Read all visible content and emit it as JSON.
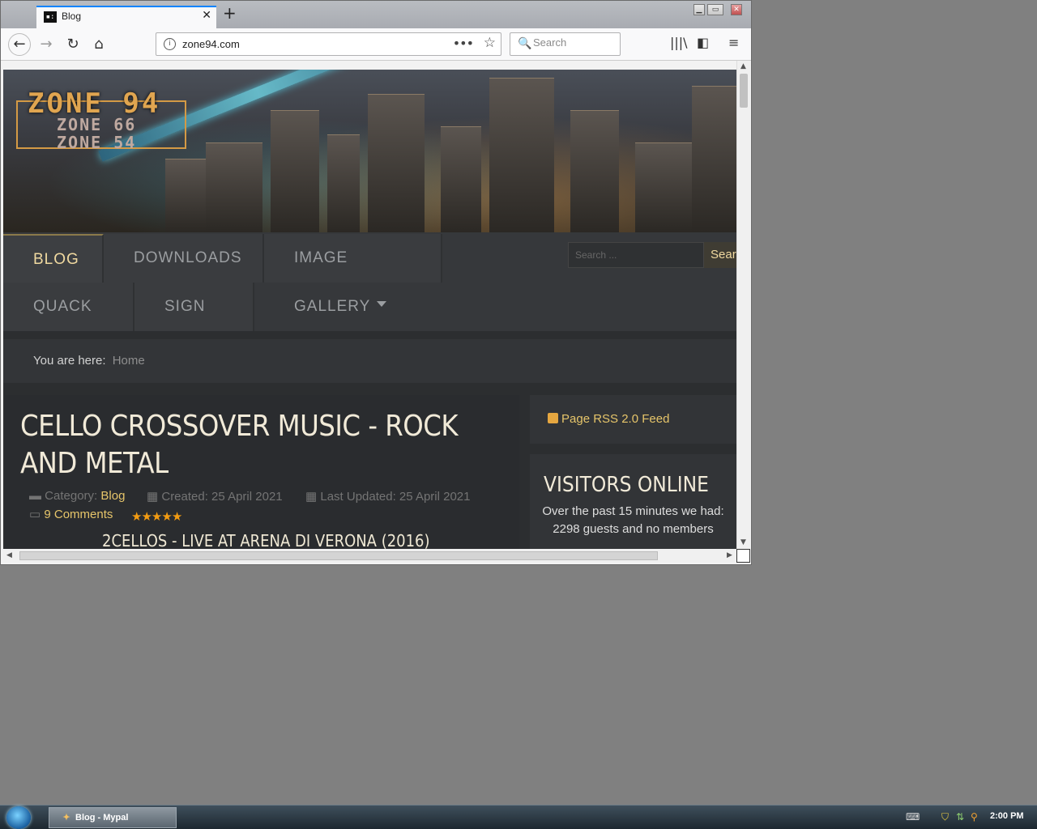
{
  "browser": {
    "tab_title": "Blog",
    "tab_favicon": "▪:",
    "url": "zone94.com",
    "search_placeholder": "Search",
    "window_controls": [
      "minimize",
      "maximize",
      "close"
    ]
  },
  "site": {
    "logo": {
      "main": "ZONE 94",
      "sub1": "ZONE 66",
      "sub2": "ZONE 54"
    },
    "menu": [
      {
        "label": "BLOG",
        "dropdown": true,
        "active": true
      },
      {
        "label": "DOWNLOADS",
        "dropdown": true
      },
      {
        "label": "IMAGE GALLERY",
        "dropdown": true
      },
      {
        "label": "QUACK IT",
        "dropdown": false
      },
      {
        "label": "SIGN IN",
        "dropdown": true
      }
    ],
    "search_placeholder": "Search ...",
    "search_button": "Sear",
    "breadcrumb": {
      "prefix": "You are here:",
      "home": "Home"
    }
  },
  "article": {
    "title": "CELLO CROSSOVER MUSIC - ROCK AND METAL",
    "category_label": "Category:",
    "category": "Blog",
    "created": "Created: 25 April 2021",
    "updated": "Last Updated: 25 April 2021",
    "comments": "9 Comments",
    "rating_stars": 5,
    "video_title": "2CELLOS - LIVE AT ARENA DI VERONA (2016)"
  },
  "sidebar": {
    "rss": "Page RSS 2.0 Feed",
    "visitors_heading": "VISITORS ONLINE",
    "visitors_text": "Over the past 15 minutes we had:",
    "visitors_count": "2298 guests and no members"
  },
  "taskbar": {
    "task_label": "Blog - Mypal",
    "clock": "2:00 PM"
  },
  "colors": {
    "accent_gold": "#e6c56a",
    "page_bg": "#2c2e30",
    "star_orange": "#f39c12"
  }
}
